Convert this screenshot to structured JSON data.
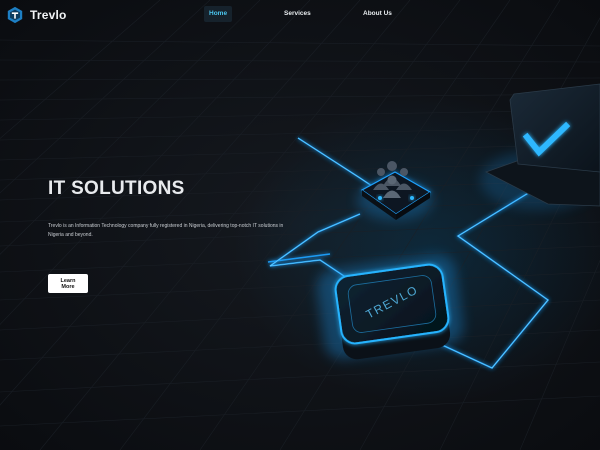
{
  "brand": {
    "name": "Trevlo",
    "logo_icon": "trevlo-logo-icon"
  },
  "nav": {
    "items": [
      {
        "label": "Home",
        "active": true
      },
      {
        "label": "Services",
        "active": false
      },
      {
        "label": "About Us",
        "active": false
      }
    ]
  },
  "hero": {
    "title": "IT SOLUTIONS",
    "description": "Trevlo is an Information Technology company fully registered in Nigeria, delivering top-notch IT solutions in Nigeria and beyond.",
    "cta_label": "Learn More"
  },
  "illustration": {
    "chip_label": "TREVLO",
    "icons": [
      "users-group-icon",
      "checkmark-icon"
    ]
  },
  "colors": {
    "background": "#0a0c10",
    "accent": "#4cc7f0",
    "glow": "#1fa2ff",
    "text": "#e8eaed"
  }
}
